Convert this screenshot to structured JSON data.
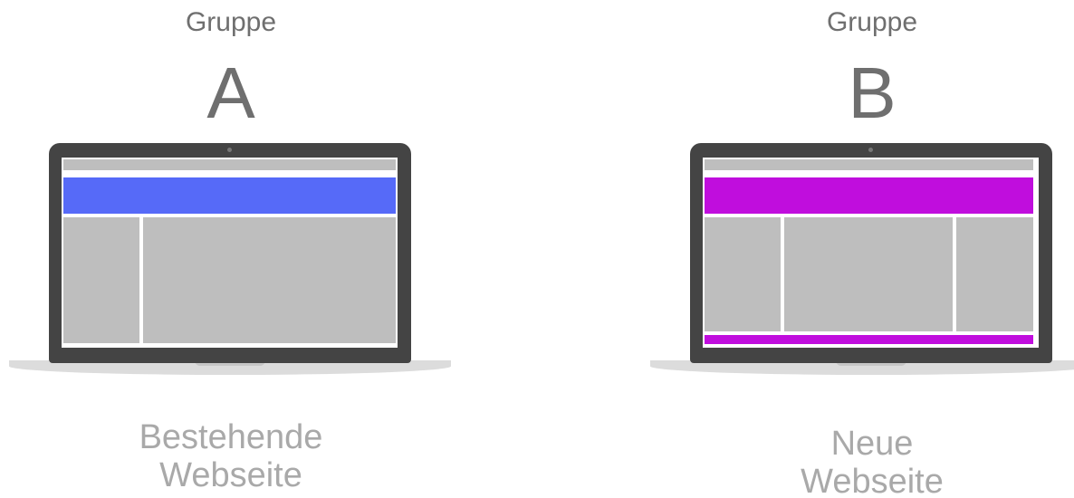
{
  "groups": [
    {
      "caption": "Gruppe",
      "letter": "A",
      "description_line1": "Bestehende",
      "description_line2": "Webseite",
      "accent_color": "#566af8"
    },
    {
      "caption": "Gruppe",
      "letter": "B",
      "description_line1": "Neue",
      "description_line2": "Webseite",
      "accent_color": "#c00ddd"
    }
  ]
}
